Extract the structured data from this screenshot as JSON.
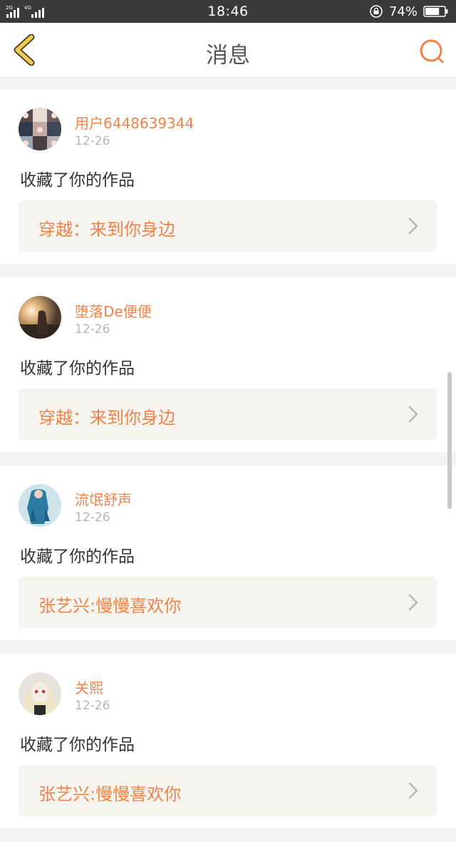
{
  "status_bar": {
    "network_labels": "2G 4G",
    "time": "18:46",
    "battery_percent": "74%",
    "battery_level": 0.74
  },
  "nav": {
    "title": "消息",
    "back_icon": "chevron-left-icon",
    "search_icon": "search-icon"
  },
  "colors": {
    "accent": "#f0834a",
    "back_icon": "#f2c94c",
    "status_bg": "#3a3a3a",
    "link_bg": "#f5f4ef"
  },
  "notifications": [
    {
      "username": "用户6448639344",
      "date": "12-26",
      "action": "收藏了你的作品",
      "work_title": "穿越：来到你身边"
    },
    {
      "username": "堕落De便便",
      "date": "12-26",
      "action": "收藏了你的作品",
      "work_title": "穿越：来到你身边"
    },
    {
      "username": "流氓舒声",
      "date": "12-26",
      "action": "收藏了你的作品",
      "work_title": "张艺兴:慢慢喜欢你"
    },
    {
      "username": "关熙",
      "date": "12-26",
      "action": "收藏了你的作品",
      "work_title": "张艺兴:慢慢喜欢你"
    }
  ]
}
